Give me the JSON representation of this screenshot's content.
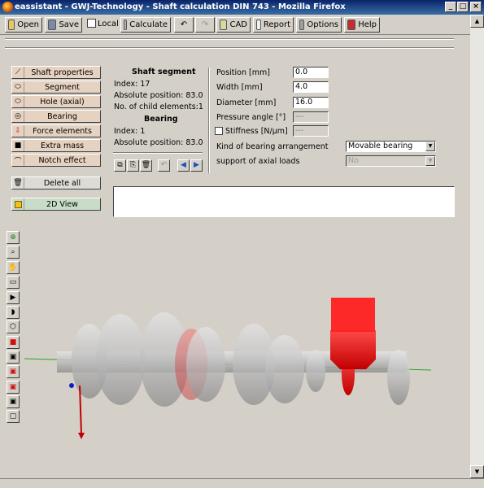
{
  "window": {
    "title": "eassistant - GWJ-Technology - Shaft calculation DIN 743 - Mozilla Firefox"
  },
  "toolbar": {
    "open": "Open",
    "save": "Save",
    "local": "Local",
    "calculate": "Calculate",
    "cad": "CAD",
    "report": "Report",
    "options": "Options",
    "help": "Help"
  },
  "sidebar": {
    "items": [
      {
        "label": "Shaft properties",
        "icon": "shaft-properties-icon"
      },
      {
        "label": "Segment",
        "icon": "segment-icon"
      },
      {
        "label": "Hole (axial)",
        "icon": "hole-icon"
      },
      {
        "label": "Bearing",
        "icon": "bearing-icon"
      },
      {
        "label": "Force elements",
        "icon": "force-icon"
      },
      {
        "label": "Extra mass",
        "icon": "mass-icon"
      },
      {
        "label": "Notch effect",
        "icon": "notch-icon"
      }
    ],
    "delete_all": "Delete all",
    "view_2d": "2D View"
  },
  "info": {
    "segment_heading": "Shaft segment",
    "segment_index": "Index: 17",
    "segment_abs_pos": "Absolute position: 83.0",
    "segment_children": "No. of child elements:1",
    "bearing_heading": "Bearing",
    "bearing_index": "Index: 1",
    "bearing_abs_pos": "Absolute position: 83.0"
  },
  "fields": {
    "position": {
      "label": "Position [mm]",
      "value": "0.0"
    },
    "width": {
      "label": "Width [mm]",
      "value": "4.0"
    },
    "diameter": {
      "label": "Diameter [mm]",
      "value": "16.0"
    },
    "pressure_angle": {
      "label": "Pressure angle [°]",
      "value": "---"
    },
    "stiffness": {
      "label": "Stiffness [N/µm]",
      "value": "---"
    },
    "bearing_arrangement": {
      "label": "Kind of bearing arrangement",
      "value": "Movable bearing"
    },
    "axial_loads": {
      "label": "support of axial loads",
      "value": "No"
    }
  },
  "colors": {
    "gear": "#c8c8c8",
    "highlight": "#e81010",
    "axis_green": "#2aa02a",
    "title_bar": "#0a246a"
  }
}
